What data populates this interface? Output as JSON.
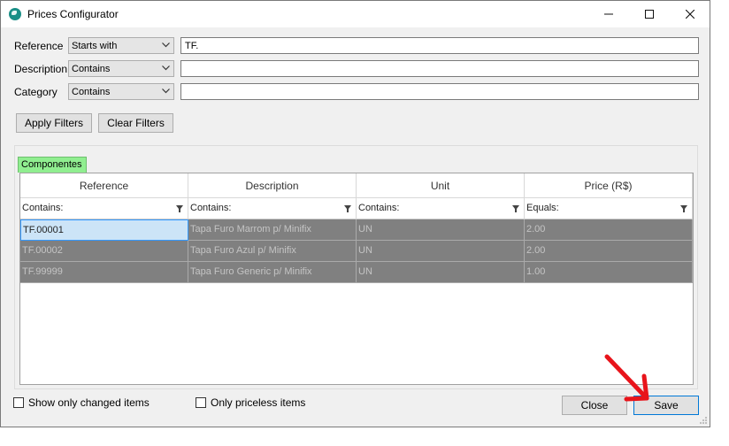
{
  "window": {
    "title": "Prices Configurator",
    "controls": {
      "minimize": "minimize-icon",
      "maximize": "maximize-icon",
      "close": "close-icon"
    }
  },
  "filters": {
    "reference": {
      "label": "Reference",
      "mode": "Starts with",
      "value": "TF."
    },
    "description": {
      "label": "Description",
      "mode": "Contains",
      "value": ""
    },
    "category": {
      "label": "Category",
      "mode": "Contains",
      "value": ""
    }
  },
  "buttons": {
    "apply": "Apply Filters",
    "clear": "Clear Filters",
    "close": "Close",
    "save": "Save"
  },
  "tab": {
    "label": "Componentes"
  },
  "grid": {
    "columns": [
      "Reference",
      "Description",
      "Unit",
      "Price (R$)"
    ],
    "filter_row": [
      "Contains:",
      "Contains:",
      "Contains:",
      "Equals:"
    ],
    "rows": [
      [
        "TF.00001",
        "Tapa Furo Marrom p/ Minifix",
        "UN",
        "2.00"
      ],
      [
        "TF.00002",
        "Tapa Furo Azul p/ Minifix",
        "UN",
        "2.00"
      ],
      [
        "TF.99999",
        "Tapa Furo Generic p/ Minifix",
        "UN",
        "1.00"
      ]
    ]
  },
  "options": {
    "changed_only": "Show only changed items",
    "priceless_only": "Only priceless items"
  },
  "colors": {
    "tab_bg": "#90ee90",
    "row_bg": "#808080",
    "selected_bg": "#cce4f7",
    "arrow": "#e8141b"
  }
}
